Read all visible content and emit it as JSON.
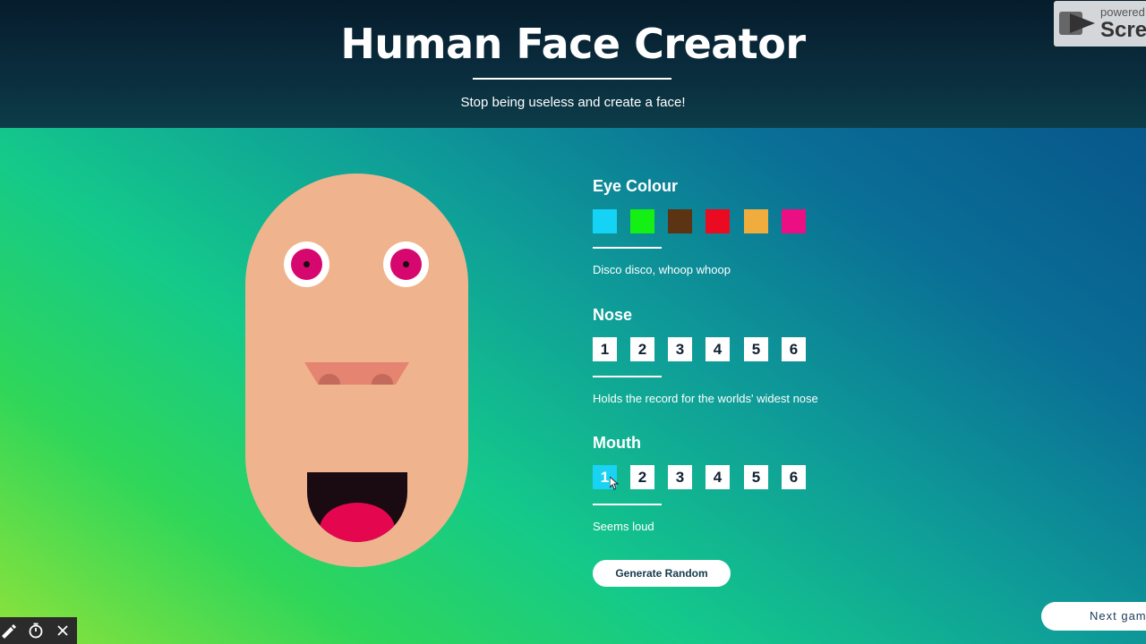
{
  "header": {
    "title": "Human Face Creator",
    "subtitle": "Stop being useless and create a face!"
  },
  "watermark": {
    "small_text": "powered",
    "big_text": "Scree"
  },
  "face": {
    "skin_color": "#efb48d",
    "eye_color": "#d6086f",
    "nose_shape": 1,
    "mouth_shape": 1
  },
  "controls": {
    "eye_colour": {
      "title": "Eye Colour",
      "swatches": [
        "#15d3f5",
        "#14f014",
        "#5c3313",
        "#ea0b22",
        "#f0ad3e",
        "#ec0f83"
      ],
      "description": "Disco disco, whoop whoop"
    },
    "nose": {
      "title": "Nose",
      "options": [
        "1",
        "2",
        "3",
        "4",
        "5",
        "6"
      ],
      "selected": 1,
      "description": "Holds the record for the worlds' widest nose"
    },
    "mouth": {
      "title": "Mouth",
      "options": [
        "1",
        "2",
        "3",
        "4",
        "5",
        "6"
      ],
      "selected": 1,
      "description": "Seems loud"
    }
  },
  "buttons": {
    "generate_random": "Generate Random",
    "next_game": "Next gam"
  },
  "toolbar": {
    "icons": [
      "pen-icon",
      "timer-icon",
      "close-icon"
    ]
  }
}
